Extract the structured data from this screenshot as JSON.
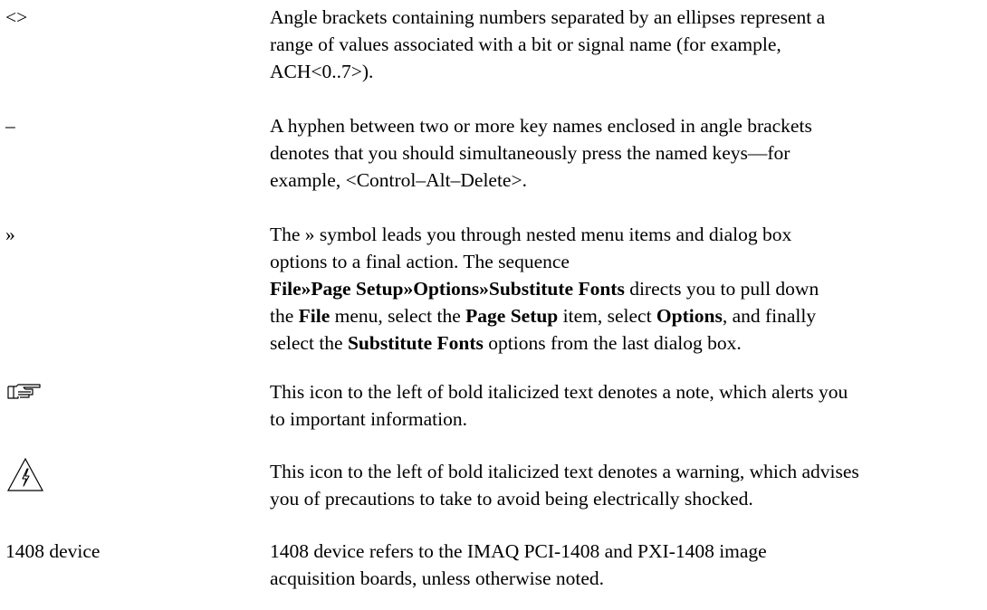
{
  "conventions": [
    {
      "term": "<>",
      "lines": [
        "Angle brackets containing numbers separated by an ellipses represent a",
        "range of values associated with a bit or signal name (for example,",
        "ACH<0..7>)."
      ]
    },
    {
      "term": "–",
      "lines": [
        "A hyphen between two or more key names enclosed in angle brackets",
        "denotes that you should simultaneously press the named keys—for",
        "example, <Control–Alt–Delete>."
      ]
    },
    {
      "term": "»",
      "line1": "The » symbol leads you through nested menu items and dialog box",
      "line2": "options to a final action. The sequence",
      "seq": "File»Page Setup»Options»Substitute Fonts",
      "seq_tail": " directs you to pull down",
      "l4_a": "the ",
      "l4_file": "File",
      "l4_b": " menu, select the ",
      "l4_page": "Page Setup",
      "l4_c": " item, select ",
      "l4_options": "Options",
      "l4_d": ", and finally",
      "l5_a": "select the ",
      "l5_sub": "Substitute Fonts",
      "l5_b": " options from the last dialog box."
    },
    {
      "icon": "pointing-hand-note-icon",
      "lines": [
        "This icon to the left of bold italicized text denotes a note, which alerts you",
        "to important information."
      ]
    },
    {
      "icon": "electrical-warning-icon",
      "lines": [
        "This icon to the left of bold italicized text denotes a warning, which advises",
        "you of precautions to take to avoid being electrically shocked."
      ]
    },
    {
      "term": "1408 device",
      "lines": [
        "1408 device refers to the IMAQ PCI-1408 and PXI-1408 image",
        "acquisition boards, unless otherwise noted."
      ]
    }
  ]
}
